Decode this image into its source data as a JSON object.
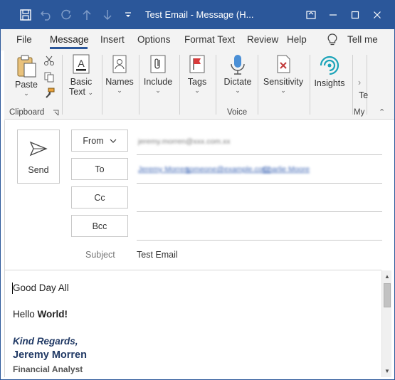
{
  "window": {
    "title": "Test Email  -  Message (H...",
    "colors": {
      "titlebar": "#2b579a",
      "ribbon": "#f3f3f3",
      "accent": "#2b579a",
      "signature": "#1f3864"
    }
  },
  "tabs": [
    {
      "label": "File"
    },
    {
      "label": "Message",
      "active": true
    },
    {
      "label": "Insert"
    },
    {
      "label": "Options"
    },
    {
      "label": "Format Text"
    },
    {
      "label": "Review"
    },
    {
      "label": "Help"
    },
    {
      "label": "Tell me"
    }
  ],
  "ribbon": {
    "paste": "Paste",
    "basic_text_1": "Basic",
    "basic_text_2": "Text",
    "names": "Names",
    "include": "Include",
    "tags": "Tags",
    "dictate": "Dictate",
    "sensitivity": "Sensitivity",
    "insights": "Insights",
    "more_partial": "Te",
    "groups": {
      "clipboard": "Clipboard",
      "voice": "Voice",
      "my": "My"
    }
  },
  "compose": {
    "send": "Send",
    "from_label": "From",
    "to_label": "To",
    "cc_label": "Cc",
    "bcc_label": "Bcc",
    "subject_label": "Subject",
    "subject_value": "Test Email",
    "from_value": "jeremy.morren@xxx.com.xx",
    "to_value_1": "Jeremy Morren;",
    "to_value_2": "someone@example.com;",
    "to_value_3": "Charlie Moore"
  },
  "body": {
    "greeting": "Good Day All",
    "hello": "Hello ",
    "hello_bold": "World!",
    "regards": "Kind Regards,",
    "name": "Jeremy Morren",
    "role": "Financial Analyst"
  }
}
